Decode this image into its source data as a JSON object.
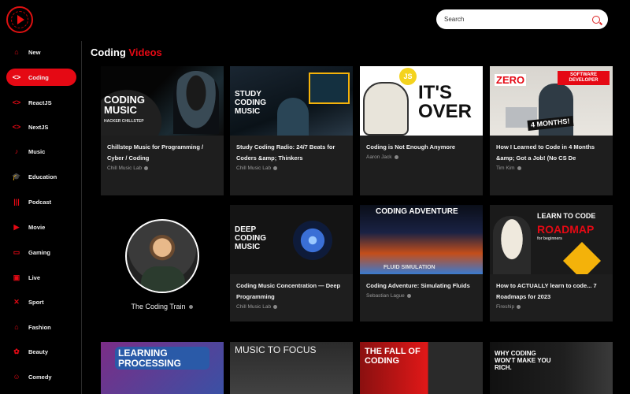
{
  "header": {
    "search_placeholder": "Search"
  },
  "sidebar": {
    "items": [
      {
        "label": "New",
        "icon": "home-icon",
        "glyph": "⌂",
        "active": false
      },
      {
        "label": "Coding",
        "icon": "code-icon",
        "glyph": "<>",
        "active": true
      },
      {
        "label": "ReactJS",
        "icon": "code-icon",
        "glyph": "<>",
        "active": false
      },
      {
        "label": "NextJS",
        "icon": "code-icon",
        "glyph": "<>",
        "active": false
      },
      {
        "label": "Music",
        "icon": "music-note-icon",
        "glyph": "♪",
        "active": false
      },
      {
        "label": "Education",
        "icon": "graduation-cap-icon",
        "glyph": "🎓",
        "active": false
      },
      {
        "label": "Podcast",
        "icon": "podcast-icon",
        "glyph": "|||",
        "active": false
      },
      {
        "label": "Movie",
        "icon": "movie-icon",
        "glyph": "▶",
        "active": false
      },
      {
        "label": "Gaming",
        "icon": "gamepad-icon",
        "glyph": "▭",
        "active": false
      },
      {
        "label": "Live",
        "icon": "live-tv-icon",
        "glyph": "▣",
        "active": false
      },
      {
        "label": "Sport",
        "icon": "sport-icon",
        "glyph": "✕",
        "active": false
      },
      {
        "label": "Fashion",
        "icon": "hanger-icon",
        "glyph": "⌂",
        "active": false
      },
      {
        "label": "Beauty",
        "icon": "beauty-icon",
        "glyph": "✿",
        "active": false
      },
      {
        "label": "Comedy",
        "icon": "comedy-icon",
        "glyph": "☺",
        "active": false
      }
    ]
  },
  "section": {
    "title_part1": "Coding",
    "title_part2": "Videos"
  },
  "videos": [
    {
      "title": "Chillstep Music for Programming / Cyber / Coding",
      "channel": "Chill Music Lab",
      "thumb_text": "CODING MUSIC",
      "thumb_sub": "HACKER CHILLSTEP"
    },
    {
      "title": "Study Coding Radio: 24/7 Beats for Coders &amp; Thinkers",
      "channel": "Chill Music Lab",
      "thumb_text": "STUDY CODING MUSIC"
    },
    {
      "title": "Coding is Not Enough Anymore",
      "channel": "Aaron Jack",
      "thumb_text": "IT'S OVER",
      "thumb_badge": "JS"
    },
    {
      "title": "How I Learned to Code in 4 Months &amp; Got a Job! (No CS De",
      "channel": "Tim Kim",
      "thumb_text": "ZERO",
      "thumb_text2": "SOFTWARE DEVELOPER",
      "thumb_text3": "4 MONTHS!"
    },
    {
      "title": "Coding Music Concentration — Deep Programming",
      "channel": "Chill Music Lab",
      "thumb_text": "DEEP CODING MUSIC"
    },
    {
      "title": "Coding Adventure: Simulating Fluids",
      "channel": "Sebastian Lague",
      "thumb_text": "CODING ADVENTURE",
      "thumb_text2": "FLUID SIMULATION"
    },
    {
      "title": "How to ACTUALLY learn to code... 7 Roadmaps for 2023",
      "channel": "Fireship",
      "thumb_text": "LEARN TO CODE",
      "thumb_text2": "ROADMAP",
      "thumb_text3": "for beginners"
    }
  ],
  "channel_card": {
    "name": "The Coding Train"
  },
  "bottom_row": [
    {
      "thumb_text": "LEARNING PROCESSING"
    },
    {
      "thumb_text": "MUSIC TO FOCUS"
    },
    {
      "thumb_text": "THE FALL OF CODING"
    },
    {
      "thumb_text": "WHY CODING WON'T MAKE YOU RICH."
    }
  ],
  "colors": {
    "accent": "#e50914",
    "background": "#000000",
    "card": "#1e1e1e"
  }
}
